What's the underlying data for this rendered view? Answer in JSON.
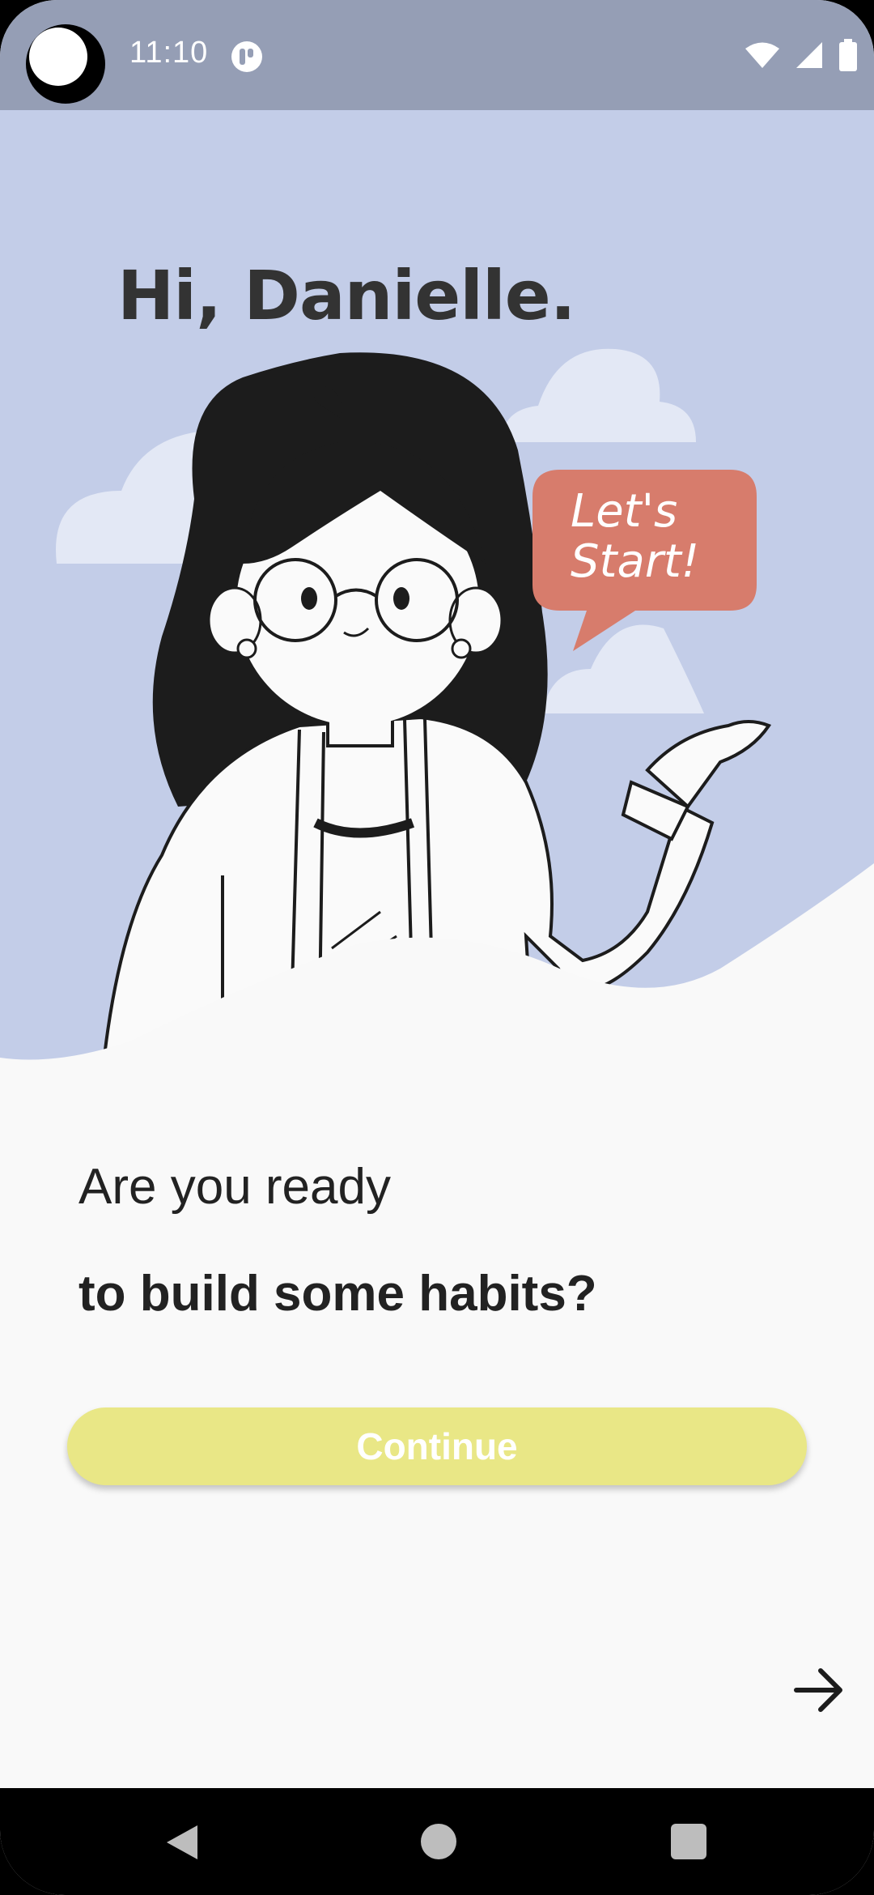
{
  "status_bar": {
    "time": "11:10",
    "icons": [
      "app-notification-icon",
      "wifi-icon",
      "cellular-signal-icon",
      "battery-icon"
    ]
  },
  "hero": {
    "greeting": "Hi, Danielle.",
    "speech_line1": "Let's",
    "speech_line2": "Start!"
  },
  "prompt": {
    "line1": "Are you ready",
    "line2": "to build some habits?"
  },
  "continue_label": "Continue",
  "colors": {
    "status_bar": "#959eb5",
    "hero_bg": "#c3cde8",
    "speech_bubble": "#d77c6c",
    "button": "#e9e786",
    "page_bg": "#f9f9f9"
  },
  "nav_bar": {
    "buttons": [
      "back",
      "home",
      "recents"
    ]
  }
}
